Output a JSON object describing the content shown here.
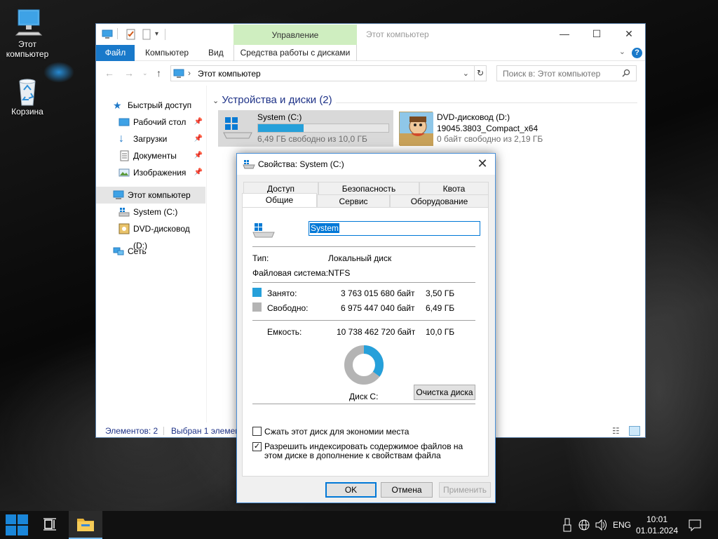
{
  "desktop": {
    "icons": [
      {
        "label": "Этот компьютер",
        "icon": "this-pc-icon"
      },
      {
        "label": "Корзина",
        "icon": "recycle-bin-icon"
      }
    ]
  },
  "explorer": {
    "title": "Этот компьютер",
    "context_tab": "Управление",
    "ribbon_tabs": [
      "Файл",
      "Компьютер",
      "Вид",
      "Средства работы с дисками"
    ],
    "address": "Этот компьютер",
    "search_placeholder": "Поиск в: Этот компьютер",
    "nav": [
      {
        "label": "Быстрый доступ",
        "icon": "star-icon"
      },
      {
        "label": "Рабочий стол",
        "icon": "desktop-icon",
        "pinned": true
      },
      {
        "label": "Загрузки",
        "icon": "download-icon",
        "pinned": true
      },
      {
        "label": "Документы",
        "icon": "documents-icon",
        "pinned": true
      },
      {
        "label": "Изображения",
        "icon": "pictures-icon",
        "pinned": true
      },
      {
        "label": "Этот компьютер",
        "icon": "this-pc-icon",
        "selected": true
      },
      {
        "label": "System (C:)",
        "icon": "drive-icon"
      },
      {
        "label": "DVD-дисковод (D:)",
        "icon": "dvd-icon"
      },
      {
        "label": "Сеть",
        "icon": "network-icon"
      }
    ],
    "group_header": "Устройства и диски (2)",
    "drives": [
      {
        "name": "System (C:)",
        "free_text": "6,49 ГБ свободно из 10,0 ГБ",
        "used_fraction": 0.35
      },
      {
        "name": "DVD-дисковод (D:)",
        "volume": "19045.3803_Compact_x64",
        "free_text": "0 байт свободно из 2,19 ГБ"
      }
    ],
    "status": {
      "items": "Элементов: 2",
      "selected": "Выбран 1 элемент"
    }
  },
  "props": {
    "title": "Свойства: System (C:)",
    "tabs_row1": [
      "Доступ",
      "Безопасность",
      "Квота"
    ],
    "tabs_row2": [
      "Общие",
      "Сервис",
      "Оборудование"
    ],
    "volume_name": "System",
    "type_label": "Тип:",
    "type_value": "Локальный диск",
    "fs_label": "Файловая система:",
    "fs_value": "NTFS",
    "used_label": "Занято:",
    "used_bytes": "3 763 015 680 байт",
    "used_gb": "3,50 ГБ",
    "free_label": "Свободно:",
    "free_bytes": "6 975 447 040 байт",
    "free_gb": "6,49 ГБ",
    "capacity_label": "Емкость:",
    "capacity_bytes": "10 738 462 720 байт",
    "capacity_gb": "10,0 ГБ",
    "used_fraction": 0.3504,
    "disk_label": "Диск C:",
    "cleanup_button": "Очистка диска",
    "compress_label": "Сжать этот диск для экономии места",
    "compress_checked": false,
    "index_label": "Разрешить индексировать содержимое файлов на этом диске в дополнение к свойствам файла",
    "index_checked": true,
    "ok": "OK",
    "cancel": "Отмена",
    "apply": "Применить",
    "colors": {
      "used": "#26a0da",
      "free": "#b4b4b4"
    }
  },
  "taskbar": {
    "language": "ENG",
    "time": "10:01",
    "date": "01.01.2024",
    "tray_icons": [
      "usb-icon",
      "network-globe-icon",
      "volume-icon"
    ]
  }
}
